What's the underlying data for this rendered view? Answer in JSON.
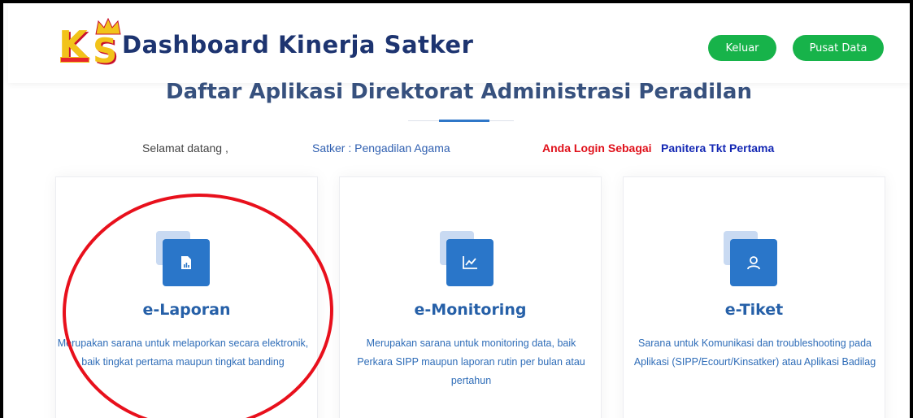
{
  "header": {
    "app_title": "Dashboard Kinerja Satker",
    "logo_letters_main": "K",
    "logo_letters_second": "S",
    "buttons": {
      "logout_label": "Keluar",
      "data_center_label": "Pusat Data"
    }
  },
  "section": {
    "title": "Daftar Aplikasi Direktorat Administrasi Peradilan"
  },
  "welcome": {
    "greeting": "Selamat datang ,",
    "satker": "Satker : Pengadilan Agama",
    "login_prefix": "Anda Login Sebagai",
    "role": "Panitera Tkt Pertama"
  },
  "apps": [
    {
      "title": "e-Laporan",
      "description": "Merupakan sarana untuk melaporkan secara elektronik, baik tingkat pertama maupun tingkat banding",
      "icon": "report-document-icon"
    },
    {
      "title": "e-Monitoring",
      "description": "Merupakan sarana untuk monitoring data, baik Perkara SIPP maupun laporan rutin per bulan atau pertahun",
      "icon": "line-chart-icon"
    },
    {
      "title": "e-Tiket",
      "description": "Sarana untuk Komunikasi dan troubleshooting pada Aplikasi (SIPP/Ecourt/Kinsatker) atau Aplikasi Badilag",
      "icon": "user-icon"
    }
  ],
  "colors": {
    "brand_title": "#1d3470",
    "button_green": "#17b34a",
    "accent_blue": "#2a76c9",
    "login_red": "#e0111b",
    "role_blue": "#1428b4",
    "annotation_red": "#e8101c"
  }
}
